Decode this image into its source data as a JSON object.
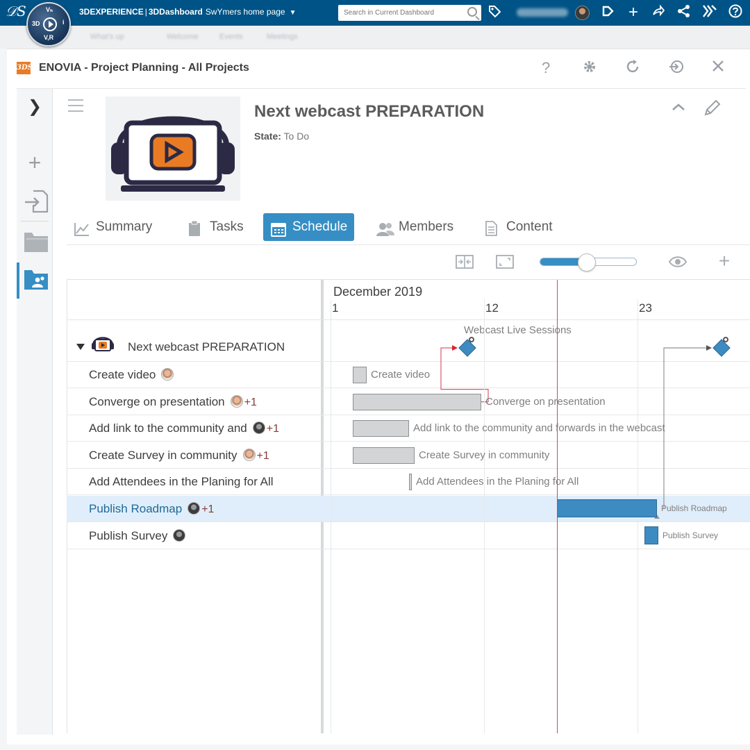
{
  "topbar": {
    "brand_3d": "3DEXPERIENCE",
    "brand_sep": "|",
    "brand_dashboard": "3DDashboard",
    "page_name": "SwYmers home page",
    "search_placeholder": "Search in Current Dashboard",
    "compass": {
      "top": "Vₕ",
      "left": "3D",
      "right": "i",
      "bottom": "V,R"
    }
  },
  "ghost_tabs": [
    "What's up",
    "Welcome",
    "Events",
    "Meetings"
  ],
  "widget": {
    "title": "ENOVIA - Project Planning - All Projects",
    "logo_text": "3DS",
    "controls": [
      "help-icon",
      "gear-icon",
      "refresh-icon",
      "expand-icon",
      "close-icon"
    ]
  },
  "project": {
    "title": "Next webcast PREPARATION",
    "state_label": "State:",
    "state_value": "To Do"
  },
  "tabs": [
    {
      "label": "Summary",
      "icon": "chart-line-icon",
      "active": false
    },
    {
      "label": "Tasks",
      "icon": "clipboard-icon",
      "active": false
    },
    {
      "label": "Schedule",
      "icon": "calendar-icon",
      "active": true
    },
    {
      "label": "Members",
      "icon": "people-icon",
      "active": false
    },
    {
      "label": "Content",
      "icon": "document-icon",
      "active": false
    }
  ],
  "zoom": {
    "level": 0.48
  },
  "gantt": {
    "month": "December 2019",
    "ticks": [
      "1",
      "12",
      "23"
    ],
    "milestone_label": "Webcast Live Sessions",
    "root": "Next webcast PREPARATION",
    "rows": [
      {
        "label": "Create video",
        "avatar": "a1",
        "extra": ""
      },
      {
        "label": "Converge on presentation",
        "avatar": "a1",
        "extra": "+1"
      },
      {
        "label": "Add link to the community and",
        "avatar": "a2",
        "extra": "+1"
      },
      {
        "label": "Create Survey in community",
        "avatar": "a1",
        "extra": "+1"
      },
      {
        "label": "Add Attendees in the Planing for All",
        "avatar": "",
        "extra": ""
      },
      {
        "label": "Publish Roadmap",
        "avatar": "a2",
        "extra": "+1",
        "highlighted": true
      },
      {
        "label": "Publish Survey",
        "avatar": "a2",
        "extra": ""
      }
    ],
    "bars": [
      {
        "label": "Create video",
        "start_day": 2.6,
        "end_day": 3.6,
        "color": "#d3d4d6"
      },
      {
        "label": "Converge on presentation",
        "start_day": 2.6,
        "end_day": 11.8,
        "color": "#d3d4d6"
      },
      {
        "label": "Add link to the community and forwards in the webcast",
        "start_day": 2.6,
        "end_day": 6.6,
        "color": "#d3d4d6"
      },
      {
        "label": "Create Survey in community",
        "start_day": 2.6,
        "end_day": 7.0,
        "color": "#d3d4d6"
      },
      {
        "label": "Add Attendees in the Planing for All",
        "start_day": 6.6,
        "end_day": 6.8,
        "color": "#d3d4d6"
      },
      {
        "label": "Publish Roadmap",
        "start_day": 17.2,
        "end_day": 24.4,
        "color": "#3e8bc1"
      },
      {
        "label": "Publish Survey",
        "start_day": 23.5,
        "end_day": 24.5,
        "color": "#3e8bc1"
      }
    ],
    "milestones_day": [
      10.8,
      29.0
    ],
    "today_day": 17.2
  }
}
